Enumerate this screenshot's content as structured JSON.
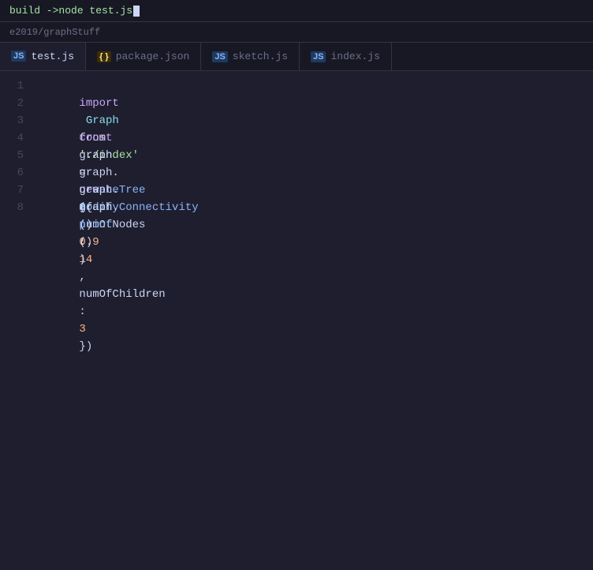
{
  "terminal": {
    "command_text": "build ->node test.js"
  },
  "breadcrumb": {
    "path": "e2019/graphStuff"
  },
  "tabs": [
    {
      "id": "test-js",
      "label": "test.js",
      "icon_type": "js",
      "active": true
    },
    {
      "id": "package-json",
      "label": "package.json",
      "icon_type": "json",
      "active": false
    },
    {
      "id": "sketch-js",
      "label": "sketch.js",
      "icon_type": "js",
      "active": false
    },
    {
      "id": "index-js",
      "label": "index.js",
      "icon_type": "js",
      "active": false
    }
  ],
  "editor": {
    "lines": [
      {
        "number": "1",
        "content": "import Graph from './index'"
      },
      {
        "number": "2",
        "content": ""
      },
      {
        "number": "3",
        "content": "const graph = new Graph()"
      },
      {
        "number": "4",
        "content": ""
      },
      {
        "number": "5",
        "content": "graph.createTree({numOfNodes: 14, numOfChildren: 3})"
      },
      {
        "number": "6",
        "content": "graph.modifyConnectivity(0.9)"
      },
      {
        "number": "7",
        "content": "graph.print()"
      },
      {
        "number": "8",
        "content": ""
      }
    ]
  }
}
